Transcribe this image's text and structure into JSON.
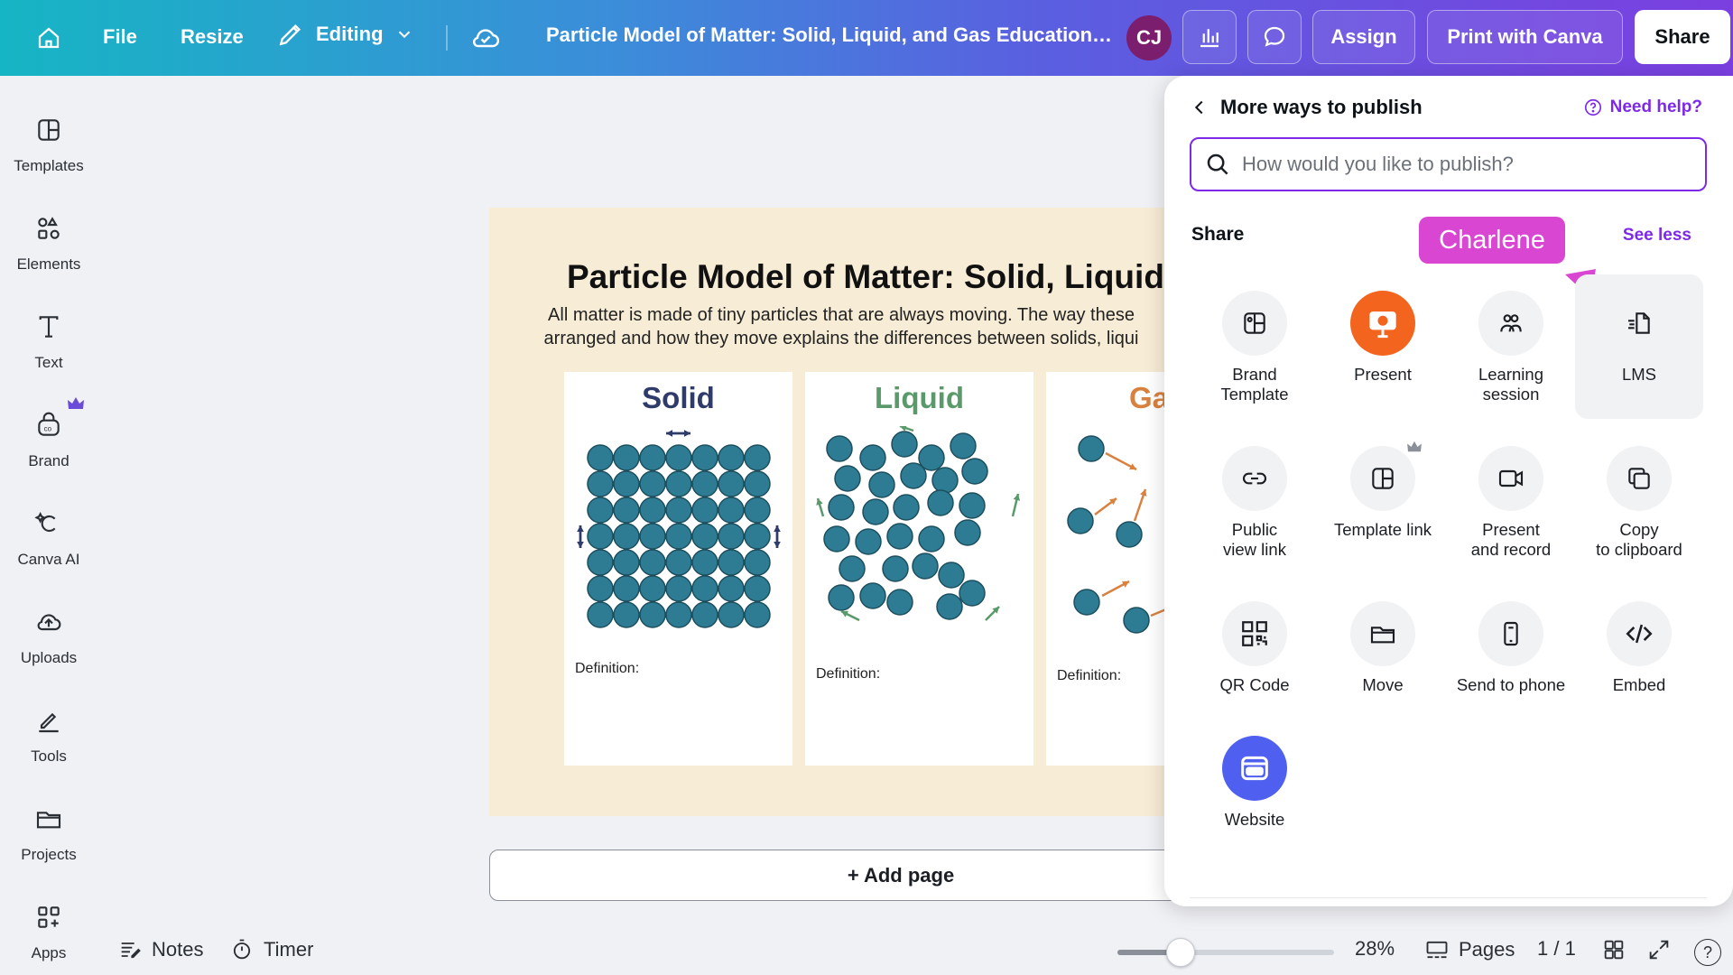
{
  "topbar": {
    "file_label": "File",
    "resize_label": "Resize",
    "editing_label": "Editing",
    "doc_title": "Particle Model of Matter: Solid, Liquid, and Gas Education…",
    "avatar_initials": "CJ",
    "assign_label": "Assign",
    "print_label": "Print with Canva",
    "share_label": "Share"
  },
  "sidebar": {
    "items": [
      {
        "label": "Templates",
        "icon": "templates-icon"
      },
      {
        "label": "Elements",
        "icon": "elements-icon"
      },
      {
        "label": "Text",
        "icon": "text-icon"
      },
      {
        "label": "Brand",
        "icon": "brand-icon"
      },
      {
        "label": "Canva AI",
        "icon": "canva-ai-icon"
      },
      {
        "label": "Uploads",
        "icon": "uploads-icon"
      },
      {
        "label": "Tools",
        "icon": "tools-icon"
      },
      {
        "label": "Projects",
        "icon": "projects-icon"
      },
      {
        "label": "Apps",
        "icon": "apps-icon"
      }
    ]
  },
  "canvas": {
    "title": "Particle Model of Matter: Solid, Liquid, a",
    "subtitle_line1": "All matter is made of tiny particles that are always moving. The way these",
    "subtitle_line2": "arranged and how they move explains the differences between solids, liqui",
    "cards": [
      {
        "title": "Solid",
        "definition": "Definition:",
        "color": "#2f3b6b"
      },
      {
        "title": "Liquid",
        "definition": "Definition:",
        "color": "#5a9a6a"
      },
      {
        "title": "Ga",
        "definition": "Definition:",
        "color": "#d9823f"
      }
    ],
    "particle_color": "#2e7c93",
    "add_page_label": "+ Add page"
  },
  "bottombar": {
    "notes_label": "Notes",
    "timer_label": "Timer",
    "zoom_value": "28%",
    "pages_label": "Pages",
    "page_count": "1 / 1",
    "help_label": "?"
  },
  "panel": {
    "title": "More ways to publish",
    "need_help": "Need help?",
    "search_placeholder": "How would you like to publish?",
    "share_heading": "Share",
    "see_less": "See less",
    "collaborator_tag": "Charlene",
    "tiles": [
      {
        "label": "Brand\nTemplate",
        "icon": "brand-template-icon"
      },
      {
        "label": "Present",
        "icon": "present-icon"
      },
      {
        "label": "Learning\nsession",
        "icon": "learning-session-icon"
      },
      {
        "label": "LMS",
        "icon": "lms-icon"
      },
      {
        "label": "Public\nview link",
        "icon": "link-icon"
      },
      {
        "label": "Template link",
        "icon": "template-link-icon"
      },
      {
        "label": "Present\nand record",
        "icon": "video-camera-icon"
      },
      {
        "label": "Copy\nto clipboard",
        "icon": "copy-icon"
      },
      {
        "label": "QR Code",
        "icon": "qr-code-icon"
      },
      {
        "label": "Move",
        "icon": "folder-icon"
      },
      {
        "label": "Send to phone",
        "icon": "phone-icon"
      },
      {
        "label": "Embed",
        "icon": "embed-icon"
      },
      {
        "label": "Website",
        "icon": "website-icon"
      }
    ],
    "accent_color": "#7d2ae8"
  }
}
